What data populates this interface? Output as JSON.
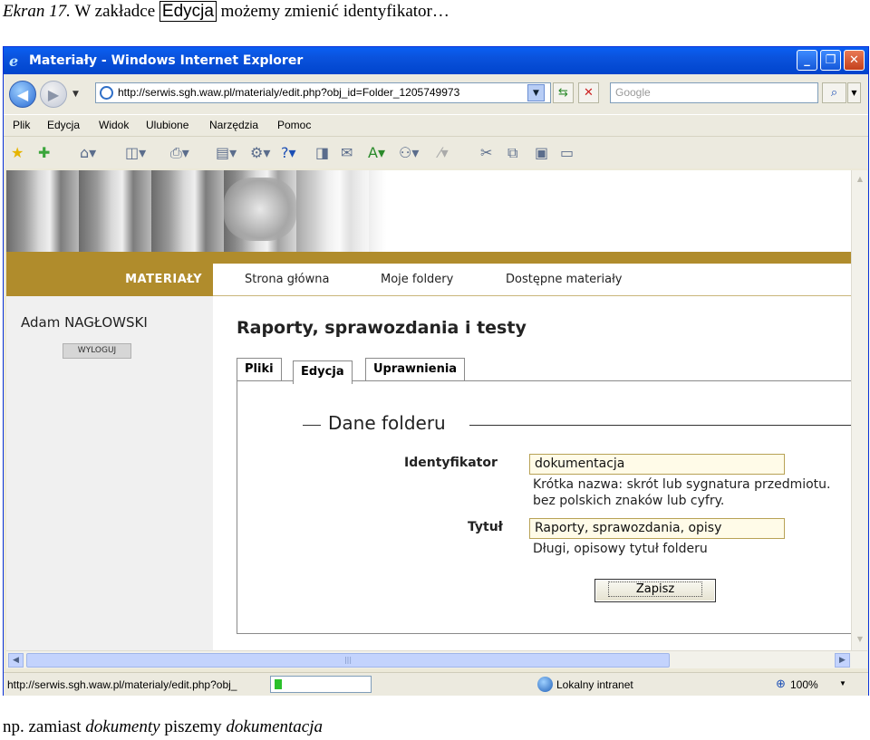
{
  "caption": {
    "prefix": "Ekran 17.",
    "text_before": " W zakładce ",
    "boxed_word": "Edycja",
    "text_after": " możemy zmienić identyfikator…"
  },
  "footer_note": {
    "prefix": "np. zamiast ",
    "word1": "dokumenty",
    "middle": " piszemy ",
    "word2": "dokumentacja"
  },
  "window": {
    "title": "Materiały - Windows Internet Explorer",
    "address_url": "http://serwis.sgh.waw.pl/materialy/edit.php?obj_id=Folder_1205749973",
    "search_placeholder": "Google",
    "menu": [
      "Plik",
      "Edycja",
      "Widok",
      "Ulubione",
      "Narzędzia",
      "Pomoc"
    ],
    "status_url": "http://serwis.sgh.waw.pl/materialy/edit.php?obj_",
    "zone": "Lokalny intranet",
    "zoom": "100%"
  },
  "site": {
    "section": "MATERIAŁY",
    "nav": [
      "Strona główna",
      "Moje foldery",
      "Dostępne materiały"
    ],
    "user_name": "Adam NAGŁOWSKI",
    "logout_label": "WYLOGUJ",
    "page_title": "Raporty, sprawozdania i testy",
    "tabs": [
      "Pliki",
      "Edycja",
      "Uprawnienia"
    ],
    "active_tab": "Edycja",
    "fieldset_legend": "Dane folderu",
    "fields": {
      "identifier_label": "Identyfikator",
      "identifier_value": "dokumentacja",
      "identifier_hint_1": "Krótka nazwa: skrót lub sygnatura przedmiotu.",
      "identifier_hint_2": "bez polskich znaków lub cyfry.",
      "title_label": "Tytuł",
      "title_value": "Raporty, sprawozdania, opisy",
      "title_hint": "Długi, opisowy tytuł folderu"
    },
    "save_label": "Zapisz"
  },
  "colors": {
    "brand_gold": "#b08c2c",
    "xp_titlebar": "#0a52dc"
  }
}
